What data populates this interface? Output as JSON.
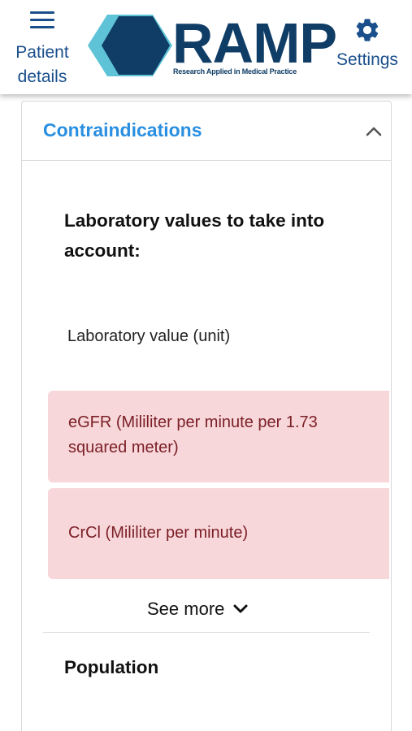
{
  "header": {
    "patient_label": "Patient\ndetails",
    "settings_label": "Settings",
    "logo": {
      "name": "RAMP",
      "tagline": "Research Applied in Medical Practice"
    }
  },
  "card": {
    "title": "Contraindications",
    "section_heading": "Laboratory values to take into account:",
    "column_label": "Laboratory value (unit)",
    "lab_values": [
      {
        "label": "eGFR (Mililiter per minute per 1.73 squared meter)"
      },
      {
        "label": "CrCl (Mililiter per minute)"
      }
    ],
    "see_more_label": "See more",
    "next_section": "Population"
  },
  "colors": {
    "brand_dark": "#0f3d66",
    "brand_light": "#5ec3d6",
    "nav_blue": "#1a4f8c",
    "accent_blue": "#2a8fe0",
    "row_bg": "#f8d7da",
    "row_text": "#7b2027"
  },
  "icons": [
    "menu-icon",
    "gear-icon",
    "chevron-up-icon",
    "chevron-down-icon"
  ]
}
